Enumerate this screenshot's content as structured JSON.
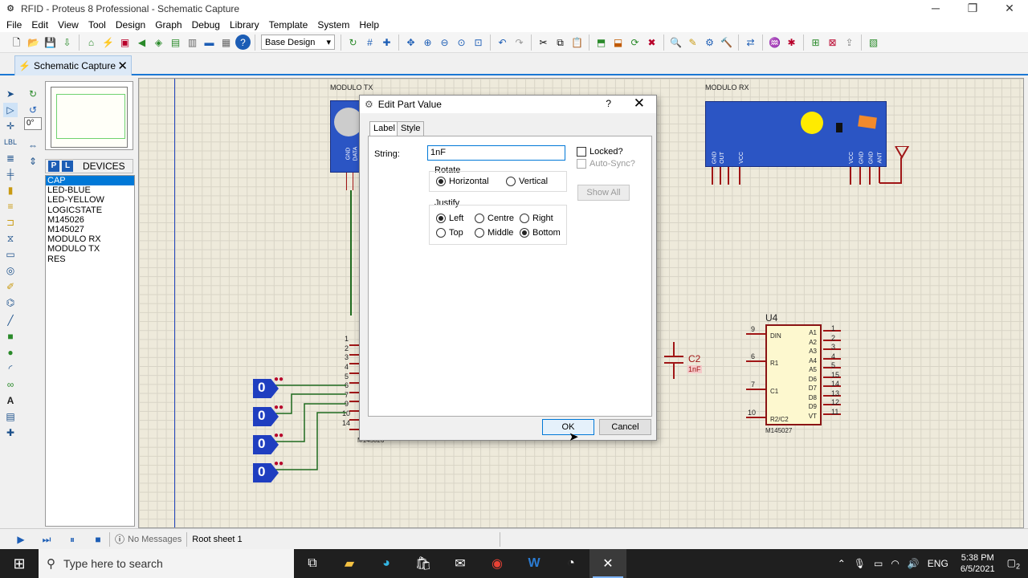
{
  "window": {
    "title": "RFID - Proteus 8 Professional - Schematic Capture",
    "minimize": "─",
    "restore": "❐",
    "close": "✕"
  },
  "menu": [
    "File",
    "Edit",
    "View",
    "Tool",
    "Design",
    "Graph",
    "Debug",
    "Library",
    "Template",
    "System",
    "Help"
  ],
  "toolbar": {
    "layer_value": "Base Design"
  },
  "tab": {
    "label": "Schematic Capture",
    "close": "✕"
  },
  "tools": {
    "rotation_value": "0°"
  },
  "devices": {
    "p_label": "P",
    "l_label": "L",
    "header": "DEVICES",
    "items": [
      "CAP",
      "LED-BLUE",
      "LED-YELLOW",
      "LOGICSTATE",
      "M145026",
      "M145027",
      "MODULO RX",
      "MODULO TX",
      "RES"
    ],
    "selected_index": 0
  },
  "schematic": {
    "modulo_tx_label": "MODULO TX",
    "modulo_rx_label": "MODULO RX",
    "tx_pins": [
      "GND",
      "DATA"
    ],
    "rx_pins_left": [
      "GND",
      "OUT",
      "VCC"
    ],
    "rx_pins_right": [
      "VCC",
      "GND",
      "GND",
      "ANT"
    ],
    "u4_ref": "U4",
    "u4_part": "M145027",
    "u4_left_pins": [
      {
        "num": "9",
        "name": "DIN"
      },
      {
        "num": "6",
        "name": "R1"
      },
      {
        "num": "7",
        "name": "C1"
      },
      {
        "num": "10",
        "name": "R2/C2"
      }
    ],
    "u4_right_pins": [
      {
        "num": "1",
        "name": "A1"
      },
      {
        "num": "2",
        "name": "A2"
      },
      {
        "num": "3",
        "name": "A3"
      },
      {
        "num": "4",
        "name": "A4"
      },
      {
        "num": "5",
        "name": "A5"
      },
      {
        "num": "15",
        "name": "D6"
      },
      {
        "num": "14",
        "name": "D7"
      },
      {
        "num": "13",
        "name": "D8"
      },
      {
        "num": "12",
        "name": "D9"
      },
      {
        "num": "11",
        "name": "VT"
      }
    ],
    "c2_ref": "C2",
    "c2_value": "1nF",
    "u3_pin_numbers": [
      "1",
      "2",
      "3",
      "4",
      "5",
      "6",
      "7",
      "9",
      "10",
      "14"
    ],
    "u3_part": "M145026",
    "logicstate_values": [
      "0",
      "0",
      "0",
      "0"
    ]
  },
  "dialog": {
    "title": "Edit Part Value",
    "help": "?",
    "close": "✕",
    "tabs": [
      "Label",
      "Style"
    ],
    "string_label": "String:",
    "string_value": "1nF",
    "rotate_label": "Rotate",
    "rotate_options": [
      "Horizontal",
      "Vertical"
    ],
    "rotate_selected": "Horizontal",
    "justify_label": "Justify",
    "justify_options": [
      "Left",
      "Centre",
      "Right",
      "Top",
      "Middle",
      "Bottom"
    ],
    "justify_selected": [
      "Left",
      "Bottom"
    ],
    "locked_label": "Locked?",
    "autosync_label": "Auto-Sync?",
    "show_all": "Show All",
    "ok": "OK",
    "cancel": "Cancel"
  },
  "status": {
    "messages": "No Messages",
    "sheet": "Root sheet 1"
  },
  "taskbar": {
    "search_placeholder": "Type here to search",
    "time": "5:38 PM",
    "date": "6/5/2021",
    "lang": "ENG",
    "notifications": "2"
  }
}
